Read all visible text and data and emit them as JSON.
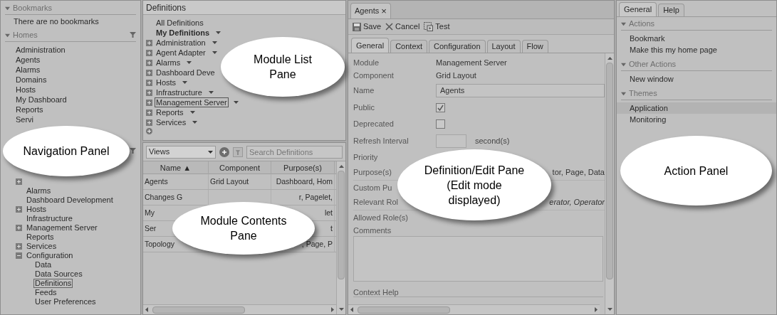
{
  "navigation": {
    "bookmarks": {
      "title": "Bookmarks",
      "expanded": true,
      "empty_text": "There are no bookmarks"
    },
    "homes": {
      "title": "Homes",
      "expanded": true,
      "items": [
        "Administration",
        "Agents",
        "Alarms",
        "Domains",
        "Hosts",
        "My Dashboard",
        "Reports",
        "Servi"
      ]
    },
    "tree": [
      {
        "expanded": false
      },
      {
        "label": "Alarms",
        "selected": false
      },
      {
        "label": "Dashboard Development",
        "selected": false
      },
      {
        "label": "Hosts",
        "expanded": false,
        "selected": false
      },
      {
        "label": "Infrastructure",
        "selected": false
      },
      {
        "label": "Management Server",
        "expanded": false,
        "selected": false
      },
      {
        "label": "Reports",
        "selected": false
      },
      {
        "label": "Services",
        "expanded": false,
        "selected": false
      },
      {
        "label": "Configuration",
        "expanded": true,
        "selected": false,
        "children": [
          {
            "label": "Data",
            "selected": false
          },
          {
            "label": "Data Sources",
            "selected": false
          },
          {
            "label": "Definitions",
            "selected": true
          },
          {
            "label": "Feeds",
            "selected": false
          },
          {
            "label": "User Preferences",
            "selected": false
          }
        ]
      }
    ]
  },
  "module_list": {
    "title": "Definitions",
    "items": [
      {
        "label": "All Definitions",
        "bold": false,
        "menu": false,
        "selected": false
      },
      {
        "label": "My Definitions",
        "bold": true,
        "menu": true,
        "selected": false
      },
      {
        "label": "Administration",
        "expanded": false,
        "bold": false,
        "menu": true,
        "selected": false
      },
      {
        "label": "Agent Adapter",
        "expanded": false,
        "bold": false,
        "menu": true,
        "selected": false
      },
      {
        "label": "Alarms",
        "expanded": false,
        "bold": false,
        "menu": true,
        "selected": false
      },
      {
        "label": "Dashboard Deve",
        "expanded": false,
        "bold": false,
        "menu": false,
        "selected": false
      },
      {
        "label": "Hosts",
        "expanded": false,
        "bold": false,
        "menu": true,
        "selected": false
      },
      {
        "label": "Infrastructure",
        "expanded": false,
        "bold": false,
        "menu": true,
        "selected": false
      },
      {
        "label": "Management Server",
        "expanded": false,
        "bold": false,
        "menu": true,
        "selected": true
      },
      {
        "label": "Reports",
        "expanded": false,
        "bold": false,
        "menu": true,
        "selected": false
      },
      {
        "label": "Services",
        "expanded": false,
        "bold": false,
        "menu": true,
        "selected": false
      }
    ]
  },
  "module_contents": {
    "view_select": "Views",
    "search": {
      "placeholder": "Search Definitions"
    },
    "columns": [
      "Name ▲",
      "Component",
      "Purpose(s)"
    ],
    "rows": [
      [
        "Agents",
        "Grid Layout",
        "Dashboard, Hom"
      ],
      [
        "Changes G",
        null,
        "r, Pagelet,"
      ],
      [
        "My",
        null,
        "let"
      ],
      [
        "Ser",
        null,
        "t"
      ],
      [
        "Topology",
        null,
        ", Page, P"
      ]
    ]
  },
  "editor": {
    "tab": "Agents",
    "tab_close": "×",
    "toolbar": [
      "Save",
      "Cancel",
      "Test"
    ],
    "tabs": [
      {
        "label": "General",
        "selected": true
      },
      {
        "label": "Context",
        "selected": false
      },
      {
        "label": "Configuration",
        "selected": false
      },
      {
        "label": "Layout",
        "selected": false
      },
      {
        "label": "Flow",
        "selected": false
      }
    ],
    "fields": [
      {
        "kind": "text",
        "label": "Module",
        "value": "Management Server"
      },
      {
        "kind": "text",
        "label": "Component",
        "value": "Grid Layout"
      },
      {
        "kind": "input",
        "label": "Name",
        "value": "Agents"
      },
      {
        "kind": "checkbox",
        "label": "Public",
        "checked": true
      },
      {
        "kind": "checkbox",
        "label": "Deprecated",
        "checked": false
      },
      {
        "kind": "number",
        "label": "Refresh Interval",
        "unit": "second(s)"
      },
      {
        "kind": "select",
        "label": "Priority"
      },
      {
        "kind": "trailing",
        "label": "Purpose(s)",
        "value": "tor, Page, Data"
      },
      {
        "kind": "label",
        "label": "Custom Pu"
      },
      {
        "kind": "trailing",
        "label": "Relevant Rol",
        "value": "erator, Operator",
        "italic": true
      },
      {
        "kind": "label",
        "label": "Allowed Role(s)"
      },
      {
        "kind": "textarea",
        "label": "Comments"
      },
      {
        "kind": "help",
        "label": "Context Help"
      }
    ]
  },
  "action_panel": {
    "tabs": [
      {
        "label": "General",
        "selected": true
      },
      {
        "label": "Help",
        "selected": false
      }
    ],
    "sections": [
      {
        "title": "Actions",
        "expanded": true,
        "items": [
          {
            "label": "Bookmark",
            "selected": false
          },
          {
            "label": "Make this my home page",
            "selected": false
          }
        ]
      },
      {
        "title": "Other Actions",
        "expanded": true,
        "items": [
          {
            "label": "New window",
            "selected": false
          }
        ]
      },
      {
        "title": "Themes",
        "expanded": true,
        "items": [
          {
            "label": "Application",
            "selected": true
          },
          {
            "label": "Monitoring",
            "selected": false
          }
        ]
      }
    ]
  },
  "callouts": [
    {
      "lines": [
        "Navigation Panel"
      ]
    },
    {
      "lines": [
        "Module List",
        "Pane"
      ]
    },
    {
      "lines": [
        "Module Contents",
        "Pane"
      ]
    },
    {
      "lines": [
        "Definition/Edit Pane",
        "(Edit mode",
        "displayed)"
      ]
    },
    {
      "lines": [
        "Action Panel"
      ]
    }
  ]
}
